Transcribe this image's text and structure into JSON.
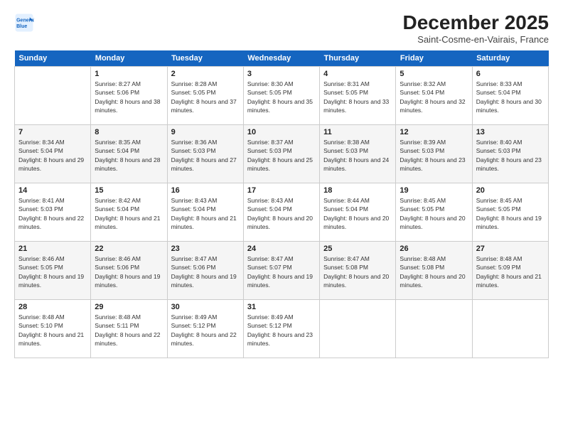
{
  "logo": {
    "line1": "General",
    "line2": "Blue"
  },
  "title": "December 2025",
  "subtitle": "Saint-Cosme-en-Vairais, France",
  "weekdays": [
    "Sunday",
    "Monday",
    "Tuesday",
    "Wednesday",
    "Thursday",
    "Friday",
    "Saturday"
  ],
  "weeks": [
    [
      {
        "day": "",
        "sunrise": "",
        "sunset": "",
        "daylight": ""
      },
      {
        "day": "1",
        "sunrise": "8:27 AM",
        "sunset": "5:06 PM",
        "daylight": "8 hours and 38 minutes."
      },
      {
        "day": "2",
        "sunrise": "8:28 AM",
        "sunset": "5:05 PM",
        "daylight": "8 hours and 37 minutes."
      },
      {
        "day": "3",
        "sunrise": "8:30 AM",
        "sunset": "5:05 PM",
        "daylight": "8 hours and 35 minutes."
      },
      {
        "day": "4",
        "sunrise": "8:31 AM",
        "sunset": "5:05 PM",
        "daylight": "8 hours and 33 minutes."
      },
      {
        "day": "5",
        "sunrise": "8:32 AM",
        "sunset": "5:04 PM",
        "daylight": "8 hours and 32 minutes."
      },
      {
        "day": "6",
        "sunrise": "8:33 AM",
        "sunset": "5:04 PM",
        "daylight": "8 hours and 30 minutes."
      }
    ],
    [
      {
        "day": "7",
        "sunrise": "8:34 AM",
        "sunset": "5:04 PM",
        "daylight": "8 hours and 29 minutes."
      },
      {
        "day": "8",
        "sunrise": "8:35 AM",
        "sunset": "5:04 PM",
        "daylight": "8 hours and 28 minutes."
      },
      {
        "day": "9",
        "sunrise": "8:36 AM",
        "sunset": "5:03 PM",
        "daylight": "8 hours and 27 minutes."
      },
      {
        "day": "10",
        "sunrise": "8:37 AM",
        "sunset": "5:03 PM",
        "daylight": "8 hours and 25 minutes."
      },
      {
        "day": "11",
        "sunrise": "8:38 AM",
        "sunset": "5:03 PM",
        "daylight": "8 hours and 24 minutes."
      },
      {
        "day": "12",
        "sunrise": "8:39 AM",
        "sunset": "5:03 PM",
        "daylight": "8 hours and 23 minutes."
      },
      {
        "day": "13",
        "sunrise": "8:40 AM",
        "sunset": "5:03 PM",
        "daylight": "8 hours and 23 minutes."
      }
    ],
    [
      {
        "day": "14",
        "sunrise": "8:41 AM",
        "sunset": "5:03 PM",
        "daylight": "8 hours and 22 minutes."
      },
      {
        "day": "15",
        "sunrise": "8:42 AM",
        "sunset": "5:04 PM",
        "daylight": "8 hours and 21 minutes."
      },
      {
        "day": "16",
        "sunrise": "8:43 AM",
        "sunset": "5:04 PM",
        "daylight": "8 hours and 21 minutes."
      },
      {
        "day": "17",
        "sunrise": "8:43 AM",
        "sunset": "5:04 PM",
        "daylight": "8 hours and 20 minutes."
      },
      {
        "day": "18",
        "sunrise": "8:44 AM",
        "sunset": "5:04 PM",
        "daylight": "8 hours and 20 minutes."
      },
      {
        "day": "19",
        "sunrise": "8:45 AM",
        "sunset": "5:05 PM",
        "daylight": "8 hours and 20 minutes."
      },
      {
        "day": "20",
        "sunrise": "8:45 AM",
        "sunset": "5:05 PM",
        "daylight": "8 hours and 19 minutes."
      }
    ],
    [
      {
        "day": "21",
        "sunrise": "8:46 AM",
        "sunset": "5:05 PM",
        "daylight": "8 hours and 19 minutes."
      },
      {
        "day": "22",
        "sunrise": "8:46 AM",
        "sunset": "5:06 PM",
        "daylight": "8 hours and 19 minutes."
      },
      {
        "day": "23",
        "sunrise": "8:47 AM",
        "sunset": "5:06 PM",
        "daylight": "8 hours and 19 minutes."
      },
      {
        "day": "24",
        "sunrise": "8:47 AM",
        "sunset": "5:07 PM",
        "daylight": "8 hours and 19 minutes."
      },
      {
        "day": "25",
        "sunrise": "8:47 AM",
        "sunset": "5:08 PM",
        "daylight": "8 hours and 20 minutes."
      },
      {
        "day": "26",
        "sunrise": "8:48 AM",
        "sunset": "5:08 PM",
        "daylight": "8 hours and 20 minutes."
      },
      {
        "day": "27",
        "sunrise": "8:48 AM",
        "sunset": "5:09 PM",
        "daylight": "8 hours and 21 minutes."
      }
    ],
    [
      {
        "day": "28",
        "sunrise": "8:48 AM",
        "sunset": "5:10 PM",
        "daylight": "8 hours and 21 minutes."
      },
      {
        "day": "29",
        "sunrise": "8:48 AM",
        "sunset": "5:11 PM",
        "daylight": "8 hours and 22 minutes."
      },
      {
        "day": "30",
        "sunrise": "8:49 AM",
        "sunset": "5:12 PM",
        "daylight": "8 hours and 22 minutes."
      },
      {
        "day": "31",
        "sunrise": "8:49 AM",
        "sunset": "5:12 PM",
        "daylight": "8 hours and 23 minutes."
      },
      {
        "day": "",
        "sunrise": "",
        "sunset": "",
        "daylight": ""
      },
      {
        "day": "",
        "sunrise": "",
        "sunset": "",
        "daylight": ""
      },
      {
        "day": "",
        "sunrise": "",
        "sunset": "",
        "daylight": ""
      }
    ]
  ]
}
